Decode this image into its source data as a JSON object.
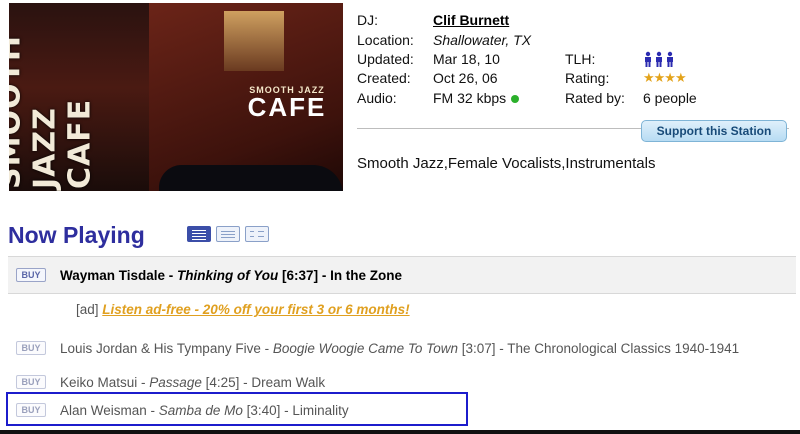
{
  "station": {
    "image_alt": "Smooth Jazz Cafe",
    "sign_vertical": "SMOOTH JAZZ CAFE",
    "sign_small": "SMOOTH JAZZ",
    "sign_big": "CAFE"
  },
  "info": {
    "dj_label": "DJ:",
    "dj_name": "Clif Burnett",
    "location_label": "Location:",
    "location": "Shallowater, TX",
    "updated_label": "Updated:",
    "updated": "Mar 18, 10",
    "created_label": "Created:",
    "created": "Oct 26, 06",
    "audio_label": "Audio:",
    "audio": "FM 32 kbps",
    "tlh_label": "TLH:",
    "tlh_icons": "listener-people-icon",
    "rating_label": "Rating:",
    "rating_stars": 4,
    "rated_by_label": "Rated by:",
    "rated_by": "6 people"
  },
  "support_button": "Support this Station",
  "genres": "Smooth Jazz,Female Vocalists,Instrumentals",
  "now_playing": {
    "heading": "Now Playing",
    "view_icons": [
      "list-view-icon",
      "compact-view-icon",
      "detail-view-icon"
    ]
  },
  "tracks": {
    "current": {
      "buy": "BUY",
      "artist": "Wayman Tisdale",
      "sep1": " - ",
      "title": "Thinking of You",
      "duration": " [6:37]",
      "sep2": " - ",
      "album": "In the Zone"
    },
    "ad": {
      "prefix": "[ad] ",
      "link": "Listen ad-free - 20% off your first 3 or 6 months!"
    },
    "past": [
      {
        "buy": "BUY",
        "artist": "Louis Jordan & His Tympany Five",
        "title": "Boogie Woogie Came To Town",
        "duration": " [3:07]",
        "album": "The Chronological Classics 1940-1941"
      },
      {
        "buy": "BUY",
        "artist": "Keiko Matsui",
        "title": "Passage",
        "duration": " [4:25]",
        "album": "Dream Walk"
      },
      {
        "buy": "BUY",
        "artist": "Alan Weisman",
        "title": "Samba de Mo",
        "duration": " [3:40]",
        "album": "Liminality"
      }
    ],
    "separator": " - "
  },
  "colors": {
    "heading": "#2e2e9e",
    "ad_link": "#e0a020",
    "audio_dot": "#2bb02b",
    "highlight_border": "#1c1ccc"
  }
}
